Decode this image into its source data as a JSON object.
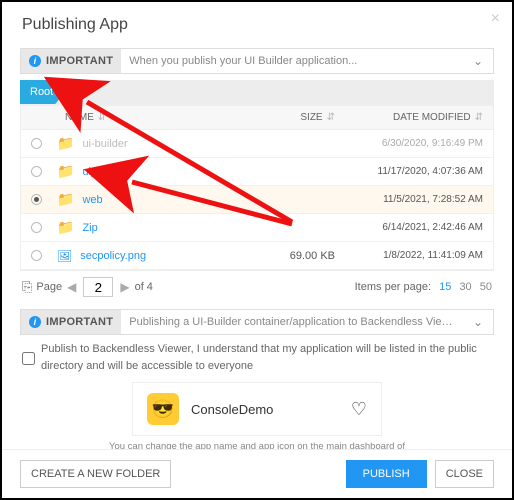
{
  "title": "Publishing App",
  "alerts": {
    "top": {
      "badge": "IMPORTANT",
      "text": "When you publish your UI Builder application..."
    },
    "mid": {
      "badge": "IMPORTANT",
      "text": "Publishing a UI-Builder container/application to Backendless Viewer..."
    }
  },
  "breadcrumb": {
    "root": "Root"
  },
  "columns": {
    "name": "NAME",
    "size": "SIZE",
    "date": "DATE MODIFIED"
  },
  "rows": [
    {
      "type": "folder",
      "name": "ui-builder",
      "size": "",
      "date": "6/30/2020, 9:16:49 PM",
      "dim": true,
      "selected": false
    },
    {
      "type": "folder",
      "name": "ui_folder",
      "size": "",
      "date": "11/17/2020, 4:07:36 AM",
      "dim": false,
      "selected": false
    },
    {
      "type": "folder",
      "name": "web",
      "size": "",
      "date": "11/5/2021, 7:28:52 AM",
      "dim": false,
      "selected": true
    },
    {
      "type": "folder",
      "name": "Zip",
      "size": "",
      "date": "6/14/2021, 2:42:46 AM",
      "dim": false,
      "selected": false
    },
    {
      "type": "file",
      "name": "secpolicy.png",
      "size": "69.00 KB",
      "date": "1/8/2022, 11:41:09 AM",
      "dim": false,
      "selected": false
    }
  ],
  "pager": {
    "label": "Page",
    "value": "2",
    "of": "of 4",
    "ipp_label": "Items per page:",
    "ipp": [
      "15",
      "30",
      "50"
    ],
    "ipp_active": "15"
  },
  "publish_check": "Publish to Backendless Viewer, I understand that my application will be listed in the public directory and will be accessible to everyone",
  "app": {
    "name": "ConsoleDemo",
    "icon": "😎",
    "hint": "You can change the app name and app icon on the main dashboard of Backendless Console"
  },
  "buttons": {
    "new_folder": "CREATE A NEW FOLDER",
    "publish": "PUBLISH",
    "close": "CLOSE"
  }
}
